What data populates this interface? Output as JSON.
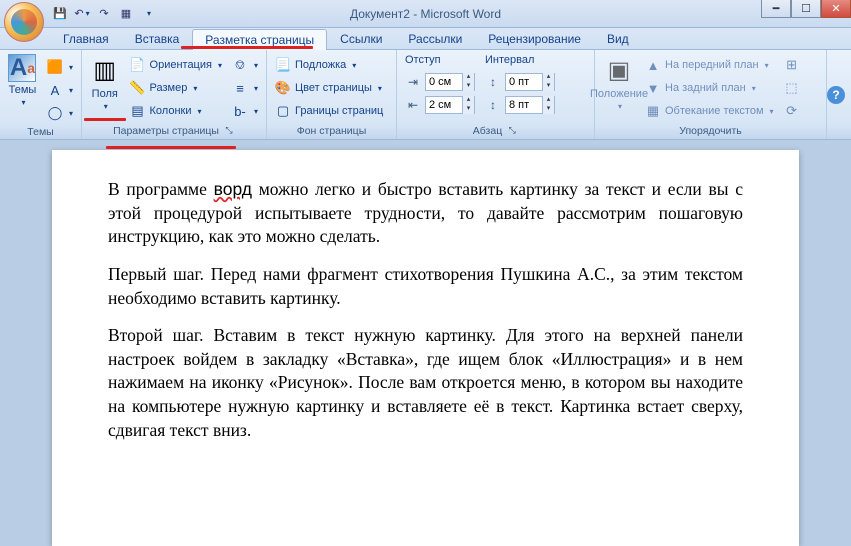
{
  "title": "Документ2 - Microsoft Word",
  "tabs": {
    "items": [
      "Главная",
      "Вставка",
      "Разметка страницы",
      "Ссылки",
      "Рассылки",
      "Рецензирование",
      "Вид"
    ],
    "activeIndex": 2
  },
  "ribbon": {
    "themes": {
      "big": "Темы",
      "label": "Темы"
    },
    "page_setup": {
      "fields": "Поля",
      "orientation": "Ориентация",
      "size": "Размер",
      "columns": "Колонки",
      "label": "Параметры страницы"
    },
    "page_bg": {
      "watermark": "Подложка",
      "color": "Цвет страницы",
      "borders": "Границы страниц",
      "label": "Фон страницы"
    },
    "paragraph": {
      "indent_label": "Отступ",
      "spacing_label": "Интервал",
      "indent_left": "0 см",
      "indent_right": "2 см",
      "spacing_before": "0 пт",
      "spacing_after": "8 пт",
      "label": "Абзац"
    },
    "arrange": {
      "position": "Положение",
      "front": "На передний план",
      "back": "На задний план",
      "wrap": "Обтекание текстом",
      "label": "Упорядочить"
    }
  },
  "document": {
    "p1": "В программе ворд можно легко и быстро вставить картинку за текст и если вы с этой процедурой испытываете трудности, то давайте рассмотрим пошаговую инструкцию, как это можно сделать.",
    "p1_squiggle": "ворд",
    "p2": "Первый шаг. Перед нами фрагмент стихотворения Пушкина А.С., за этим текстом необходимо вставить картинку.",
    "p3": "Второй шаг. Вставим в текст нужную картинку. Для этого на верхней панели настроек войдем в закладку «Вставка», где ищем блок «Иллюстрация» и в нем нажимаем на иконку «Рисунок». После вам откроется меню, в котором вы находите на компьютере нужную картинку и вставляете её в текст. Картинка встает сверху, сдвигая текст вниз."
  }
}
